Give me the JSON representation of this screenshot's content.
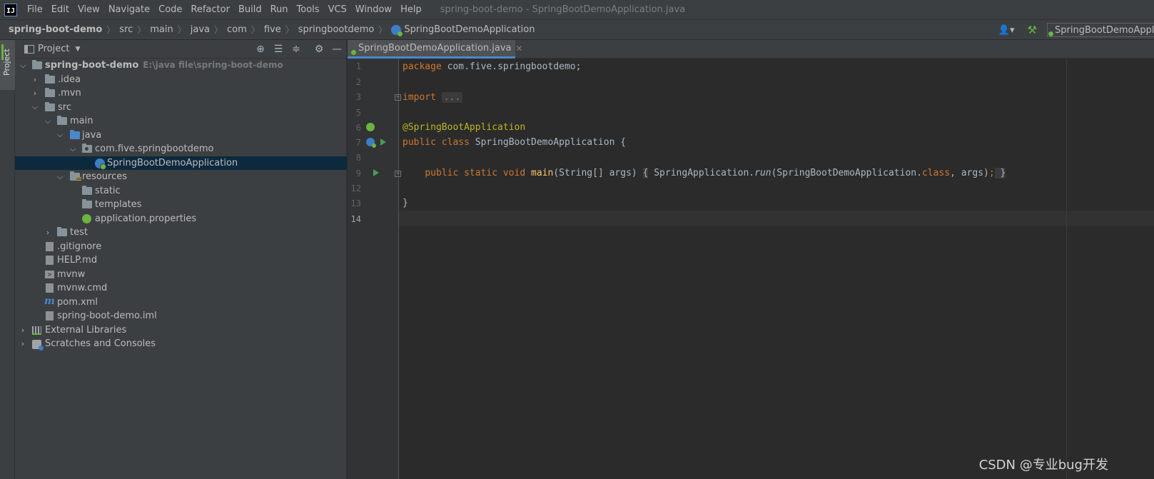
{
  "menubar": {
    "items": [
      "File",
      "Edit",
      "View",
      "Navigate",
      "Code",
      "Refactor",
      "Build",
      "Run",
      "Tools",
      "VCS",
      "Window",
      "Help"
    ],
    "window_title": "spring-boot-demo - SpringBootDemoApplication.java",
    "logo_text": "IJ"
  },
  "navbar": {
    "crumbs": [
      "spring-boot-demo",
      "src",
      "main",
      "java",
      "com",
      "five",
      "springbootdemo",
      "SpringBootDemoApplication"
    ],
    "run_config": "SpringBootDemoApplication"
  },
  "sidebar": {
    "tool_tab": "Project"
  },
  "project_panel": {
    "title": "Project",
    "tree": [
      {
        "label": "spring-boot-demo",
        "hint": "E:\\java file\\spring-boot-demo"
      },
      {
        "label": ".idea"
      },
      {
        "label": ".mvn"
      },
      {
        "label": "src"
      },
      {
        "label": "main"
      },
      {
        "label": "java"
      },
      {
        "label": "com.five.springbootdemo"
      },
      {
        "label": "SpringBootDemoApplication"
      },
      {
        "label": "resources"
      },
      {
        "label": "static"
      },
      {
        "label": "templates"
      },
      {
        "label": "application.properties"
      },
      {
        "label": "test"
      },
      {
        "label": ".gitignore"
      },
      {
        "label": "HELP.md"
      },
      {
        "label": "mvnw"
      },
      {
        "label": "mvnw.cmd"
      },
      {
        "label": "pom.xml"
      },
      {
        "label": "spring-boot-demo.iml"
      },
      {
        "label": "External Libraries"
      },
      {
        "label": "Scratches and Consoles"
      }
    ]
  },
  "editor": {
    "tab_label": "SpringBootDemoApplication.java",
    "line_numbers": [
      "1",
      "2",
      "3",
      "5",
      "6",
      "7",
      "8",
      "9",
      "12",
      "13",
      "14"
    ],
    "code": {
      "l1_kw": "package",
      "l1_rest": " com.five.springbootdemo;",
      "l3_kw": "import",
      "l3_fold": "...",
      "l6_ann": "@SpringBootApplication",
      "l7_kw": "public class",
      "l7_rest": " SpringBootDemoApplication {",
      "l9_indent": "    ",
      "l9_kw": "public static void",
      "l9_fn": "main",
      "l9_args": "(String[] args) ",
      "l9_open": "{",
      "l9_body1": " SpringApplication.",
      "l9_run": "run",
      "l9_body2": "(SpringBootDemoApplication.",
      "l9_class": "class",
      "l9_body3": ", args)",
      "l9_semi": ";",
      "l9_close": " }",
      "l13": "}"
    }
  },
  "watermark": "CSDN @专业bug开发",
  "colors": {
    "keyword": "#cc7832",
    "annotation": "#bbb529",
    "function": "#ffc66d",
    "selection": "#0d293e",
    "accent": "#4a88c7"
  }
}
